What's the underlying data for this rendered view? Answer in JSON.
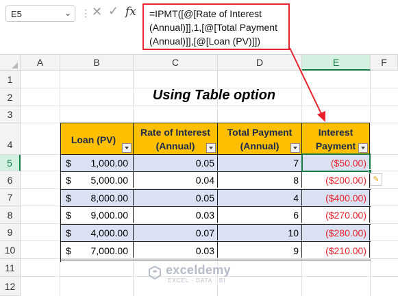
{
  "formula_bar": {
    "name_box": "E5",
    "cancel_glyph": "✕",
    "enter_glyph": "✓",
    "fx_label": "fx",
    "formula_lines": [
      "=IPMT([@[Rate of Interest",
      "(Annual)]],1,[@[Total Payment",
      "(Annual)]],[@[Loan (PV)]])"
    ]
  },
  "columns": [
    "A",
    "B",
    "C",
    "D",
    "E",
    "F"
  ],
  "rows": [
    "1",
    "2",
    "3",
    "4",
    "5",
    "6",
    "7",
    "8",
    "9",
    "10",
    "11",
    "12"
  ],
  "selected_cell": "E5",
  "title": "Using Table option",
  "table": {
    "headers": [
      [
        "Loan (PV)"
      ],
      [
        "Rate of Interest",
        "(Annual)"
      ],
      [
        "Total Payment",
        "(Annual)"
      ],
      [
        "Interest",
        "Payment"
      ]
    ],
    "rows": [
      {
        "currency": "$",
        "loan": "1,000.00",
        "rate": "0.05",
        "payment": "7",
        "interest": "($50.00)"
      },
      {
        "currency": "$",
        "loan": "5,000.00",
        "rate": "0.04",
        "payment": "8",
        "interest": "($200.00)"
      },
      {
        "currency": "$",
        "loan": "8,000.00",
        "rate": "0.05",
        "payment": "4",
        "interest": "($400.00)"
      },
      {
        "currency": "$",
        "loan": "9,000.00",
        "rate": "0.03",
        "payment": "6",
        "interest": "($270.00)"
      },
      {
        "currency": "$",
        "loan": "4,000.00",
        "rate": "0.07",
        "payment": "10",
        "interest": "($280.00)"
      },
      {
        "currency": "$",
        "loan": "7,000.00",
        "rate": "0.03",
        "payment": "9",
        "interest": "($210.00)"
      }
    ]
  },
  "watermark": {
    "name": "exceldemy",
    "tagline": "EXCEL · DATA · BI"
  },
  "colors": {
    "header_fill": "#fdbf00",
    "band_fill": "#d9e1f2",
    "negative_text": "#e8222c",
    "callout": "#e8222c",
    "selection": "#107c41"
  },
  "icons": {
    "filter_buttons": "filter-dropdown-icon",
    "quick_analysis": "quick-analysis-icon"
  }
}
